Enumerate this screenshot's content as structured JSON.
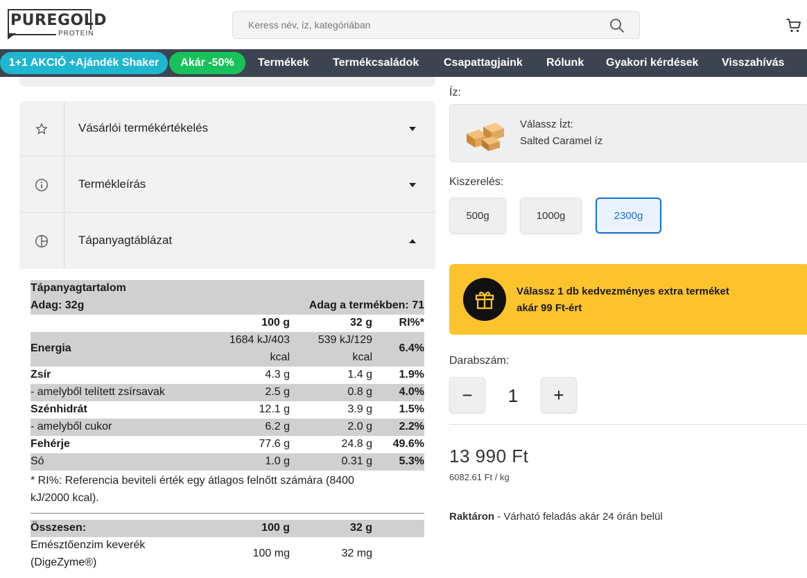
{
  "header": {
    "logo_text": "PUREGOLD",
    "logo_sub": "PROTEIN",
    "search_placeholder": "Keress név, íz, kategóriában"
  },
  "nav": {
    "promo": "1+1 AKCIÓ +Ajándék Shaker",
    "sale": "Akár -50%",
    "items": [
      "Termékek",
      "Termékcsaládok",
      "Csapattagjaink",
      "Rólunk",
      "Gyakori kérdések",
      "Visszahívás"
    ],
    "colors": {
      "bar": "#3d4451",
      "promo": "#1fb6cf",
      "sale": "#18c25a"
    }
  },
  "accordion": {
    "items": [
      {
        "label": "Vásárlói termékértékelés",
        "icon": "star-icon",
        "state": "collapsed"
      },
      {
        "label": "Termékleírás",
        "icon": "info-icon",
        "state": "collapsed"
      },
      {
        "label": "Tápanyagtáblázat",
        "icon": "pie-icon",
        "state": "expanded"
      }
    ]
  },
  "nutrition": {
    "title": "Tápanyagtartalom",
    "serving": "Adag: 32g",
    "servings_per_product": "Adag a termékben: 71",
    "col_100": "100 g",
    "col_32": "32 g",
    "col_ri": "RI%*",
    "rows": [
      {
        "name": "Energia",
        "v100_line1": "1684 kJ/403",
        "v100_line2": "kcal",
        "v32_line1": "539 kJ/129",
        "v32_line2": "kcal",
        "ri": "6.4%"
      },
      {
        "name": "Zsír",
        "v100": "4.3 g",
        "v32": "1.4 g",
        "ri": "1.9%"
      },
      {
        "name": "- amelyből telített zsírsavak",
        "v100": "2.5 g",
        "v32": "0.8 g",
        "ri": "4.0%"
      },
      {
        "name": "Szénhidrát",
        "v100": "12.1 g",
        "v32": "3.9 g",
        "ri": "1.5%"
      },
      {
        "name": "- amelyből cukor",
        "v100": "6.2 g",
        "v32": "2.0 g",
        "ri": "2.2%"
      },
      {
        "name": "Fehérje",
        "v100": "77.6 g",
        "v32": "24.8 g",
        "ri": "49.6%"
      },
      {
        "name": "Só",
        "v100": "1.0 g",
        "v32": "0.31 g",
        "ri": "5.3%"
      }
    ],
    "footnote_line1": "* RI%: Referencia beviteli érték egy átlagos felnőtt számára (8400",
    "footnote_line2": "kJ/2000 kcal).",
    "total_label": "Összesen:",
    "total_col_100": "100 g",
    "total_col_32": "32 g",
    "enzyme_line1": "Emésztőenzim keverék",
    "enzyme_line2": "(DigeZyme®)",
    "enzyme_100": "100 mg",
    "enzyme_32": "32 mg"
  },
  "product": {
    "flavor_label": "Íz:",
    "flavor_key": "Válassz Ízt:",
    "flavor_value": "Salted Caramel íz",
    "size_label": "Kiszerelés:",
    "sizes": [
      "500g",
      "1000g",
      "2300g"
    ],
    "selected_size": "2300g",
    "gift_line1_pre": "Válassz ",
    "gift_line1_bold": "1 db",
    "gift_line1_post": " kedvezményes extra terméket",
    "gift_line2": "akár 99 Ft-ért",
    "qty_label": "Darabszám:",
    "qty_minus": "−",
    "qty_value": "1",
    "qty_plus": "+",
    "price": "13 990 Ft",
    "unit_price": "6082.61 Ft / kg",
    "stock_status": "Raktáron",
    "stock_note": " - Várható feladás akár 24 órán belül",
    "colors": {
      "gift_bg": "#fdc32c",
      "active_size": "#1a6fd6"
    }
  }
}
